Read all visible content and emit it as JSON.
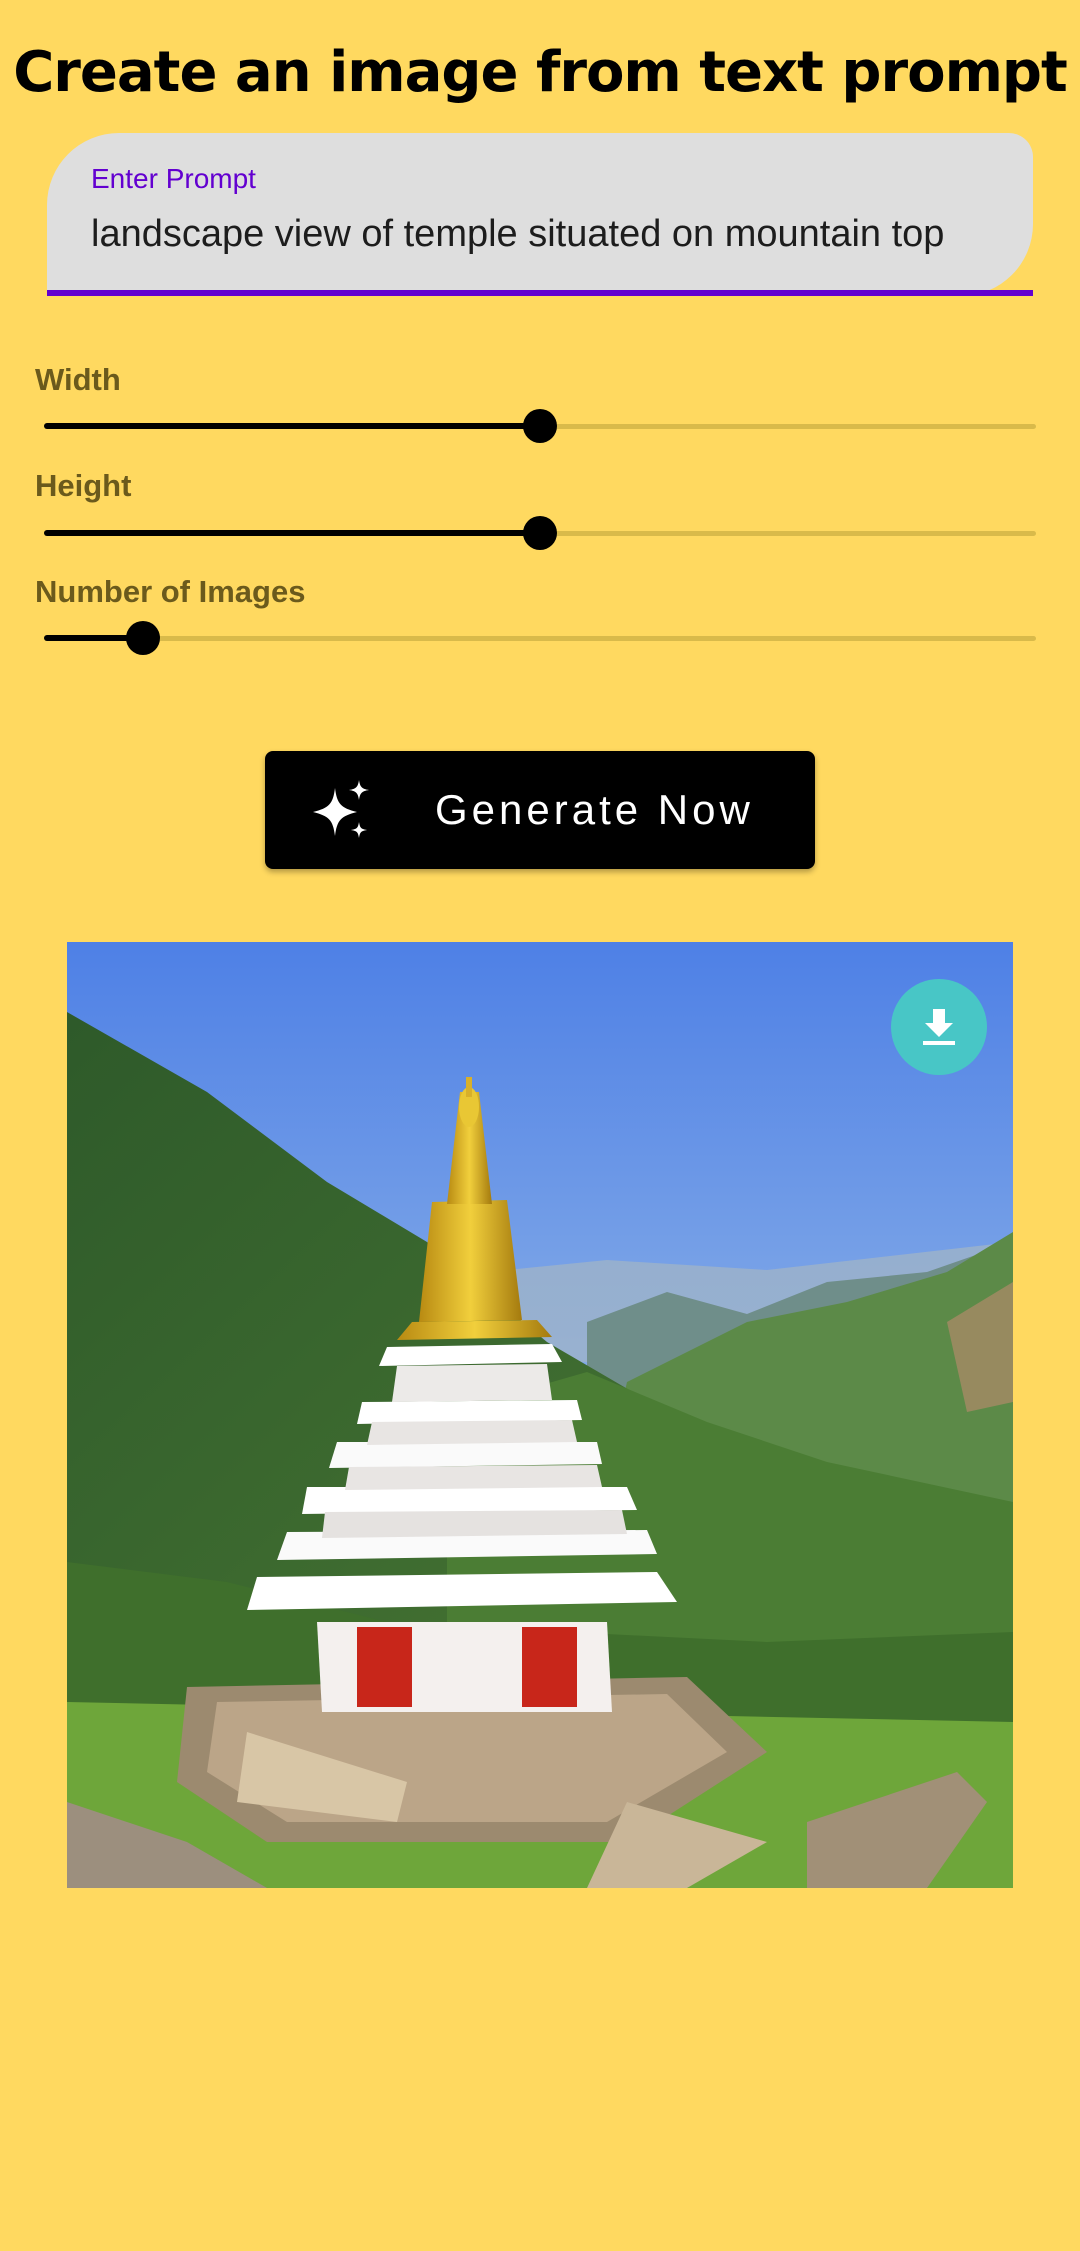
{
  "header": {
    "title": "Create an image from text prompt"
  },
  "prompt": {
    "label": "Enter Prompt",
    "value": "landscape view of temple situated on mountain top"
  },
  "sliders": [
    {
      "label": "Width",
      "value_fraction": 0.5
    },
    {
      "label": "Height",
      "value_fraction": 0.5
    },
    {
      "label": "Number of Images",
      "value_fraction": 0.1
    }
  ],
  "generate_button": {
    "label": "Generate Now",
    "icon": "sparkle-icon"
  },
  "result": {
    "image_alt": "pagoda-temple-on-mountain-image",
    "download_icon": "download-icon"
  },
  "colors": {
    "background": "#FFD960",
    "accent": "#6300D0",
    "button": "#000000",
    "download": "#48C6C6"
  }
}
